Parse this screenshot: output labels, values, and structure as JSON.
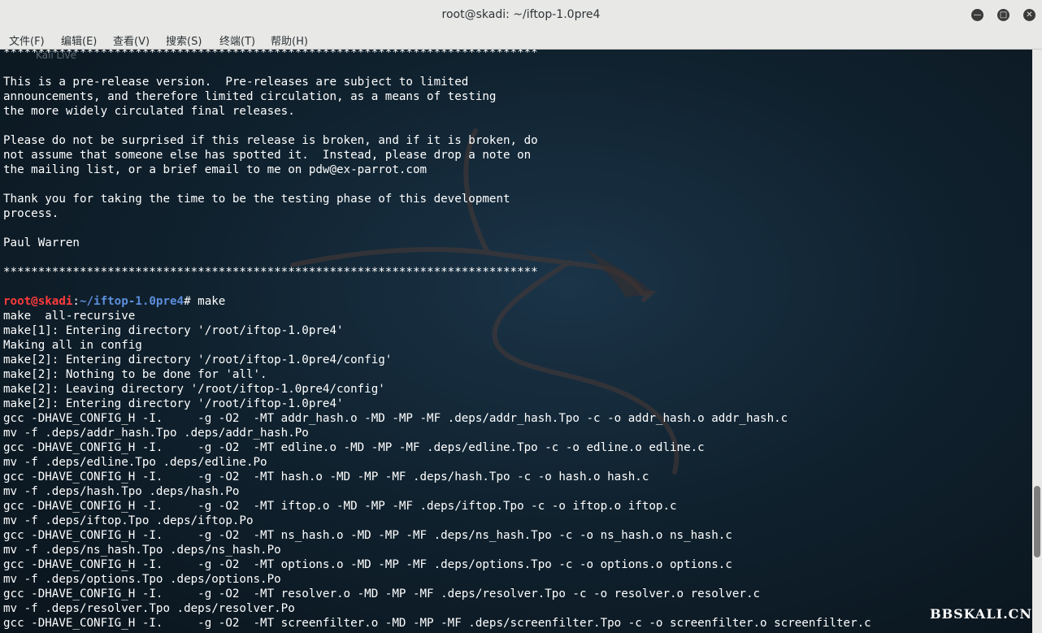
{
  "window": {
    "title": "root@skadi: ~/iftop-1.0pre4"
  },
  "menu": [
    "文件(F)",
    "编辑(E)",
    "查看(V)",
    "搜索(S)",
    "终端(T)",
    "帮助(H)"
  ],
  "ghost_label": "Kali Live",
  "prompt": {
    "user_host": "root@skadi",
    "sep": ":",
    "path": "~/iftop-1.0pre4",
    "symbol": "#",
    "command": " make"
  },
  "lines_before": [
    "*****************************************************************************",
    "",
    "This is a pre-release version.  Pre-releases are subject to limited",
    "announcements, and therefore limited circulation, as a means of testing",
    "the more widely circulated final releases.",
    "",
    "Please do not be surprised if this release is broken, and if it is broken, do",
    "not assume that someone else has spotted it.  Instead, please drop a note on",
    "the mailing list, or a brief email to me on pdw@ex-parrot.com",
    "",
    "Thank you for taking the time to be the testing phase of this development",
    "process.",
    "",
    "Paul Warren",
    "",
    "*****************************************************************************",
    ""
  ],
  "lines_after": [
    "make  all-recursive",
    "make[1]: Entering directory '/root/iftop-1.0pre4'",
    "Making all in config",
    "make[2]: Entering directory '/root/iftop-1.0pre4/config'",
    "make[2]: Nothing to be done for 'all'.",
    "make[2]: Leaving directory '/root/iftop-1.0pre4/config'",
    "make[2]: Entering directory '/root/iftop-1.0pre4'",
    "gcc -DHAVE_CONFIG_H -I.     -g -O2  -MT addr_hash.o -MD -MP -MF .deps/addr_hash.Tpo -c -o addr_hash.o addr_hash.c",
    "mv -f .deps/addr_hash.Tpo .deps/addr_hash.Po",
    "gcc -DHAVE_CONFIG_H -I.     -g -O2  -MT edline.o -MD -MP -MF .deps/edline.Tpo -c -o edline.o edline.c",
    "mv -f .deps/edline.Tpo .deps/edline.Po",
    "gcc -DHAVE_CONFIG_H -I.     -g -O2  -MT hash.o -MD -MP -MF .deps/hash.Tpo -c -o hash.o hash.c",
    "mv -f .deps/hash.Tpo .deps/hash.Po",
    "gcc -DHAVE_CONFIG_H -I.     -g -O2  -MT iftop.o -MD -MP -MF .deps/iftop.Tpo -c -o iftop.o iftop.c",
    "mv -f .deps/iftop.Tpo .deps/iftop.Po",
    "gcc -DHAVE_CONFIG_H -I.     -g -O2  -MT ns_hash.o -MD -MP -MF .deps/ns_hash.Tpo -c -o ns_hash.o ns_hash.c",
    "mv -f .deps/ns_hash.Tpo .deps/ns_hash.Po",
    "gcc -DHAVE_CONFIG_H -I.     -g -O2  -MT options.o -MD -MP -MF .deps/options.Tpo -c -o options.o options.c",
    "mv -f .deps/options.Tpo .deps/options.Po",
    "gcc -DHAVE_CONFIG_H -I.     -g -O2  -MT resolver.o -MD -MP -MF .deps/resolver.Tpo -c -o resolver.o resolver.c",
    "mv -f .deps/resolver.Tpo .deps/resolver.Po",
    "gcc -DHAVE_CONFIG_H -I.     -g -O2  -MT screenfilter.o -MD -MP -MF .deps/screenfilter.Tpo -c -o screenfilter.o screenfilter.c"
  ],
  "watermark": "BBSKALI.CN",
  "colors": {
    "prompt_user": "#ff3b3b",
    "prompt_path": "#5c8edc",
    "terminal_text": "#ffffff",
    "terminal_bg": "#10222f"
  }
}
